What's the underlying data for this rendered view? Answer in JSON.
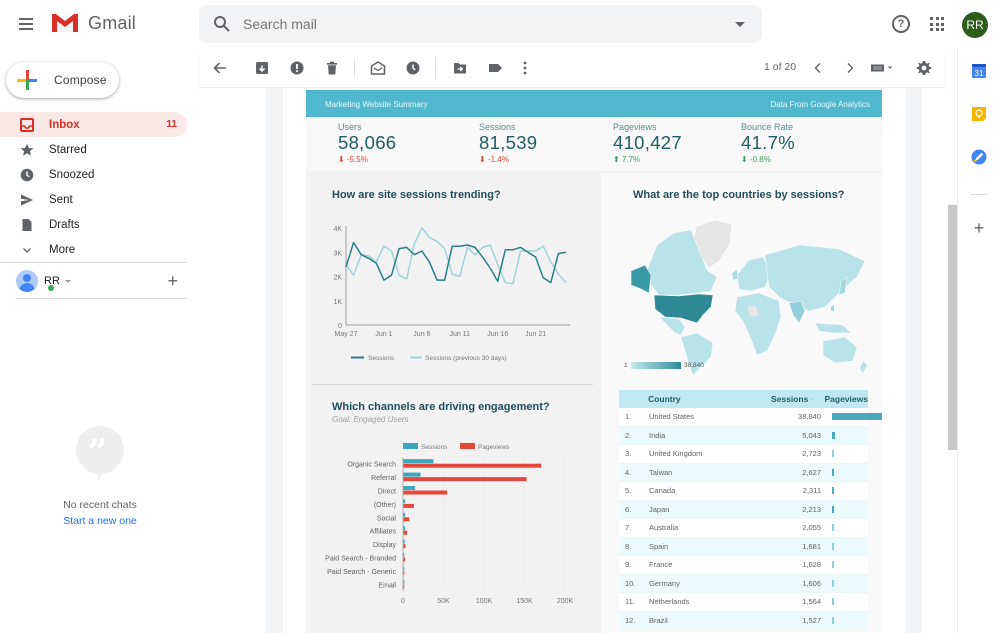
{
  "app": {
    "name": "Gmail",
    "search_placeholder": "Search mail",
    "avatar_initials": "RR"
  },
  "sidebar": {
    "compose_label": "Compose",
    "items": [
      {
        "label": "Inbox",
        "icon": "inbox-icon",
        "count": "11",
        "active": true
      },
      {
        "label": "Starred",
        "icon": "star-icon",
        "count": "",
        "active": false
      },
      {
        "label": "Snoozed",
        "icon": "clock-icon",
        "count": "",
        "active": false
      },
      {
        "label": "Sent",
        "icon": "send-icon",
        "count": "",
        "active": false
      },
      {
        "label": "Drafts",
        "icon": "draft-icon",
        "count": "",
        "active": false
      },
      {
        "label": "More",
        "icon": "chevron-down-icon",
        "count": "",
        "active": false
      }
    ],
    "user_name": "RR",
    "chat_empty_text": "No recent chats",
    "chat_start_link": "Start a new one"
  },
  "toolbar": {
    "pager": "1 of 20",
    "icons": [
      "back-arrow-icon",
      "archive-icon",
      "report-spam-icon",
      "delete-icon",
      "mark-unread-icon",
      "snooze-icon",
      "move-to-icon",
      "label-icon",
      "more-vert-icon"
    ]
  },
  "right_rail": {
    "icons": [
      "calendar-icon",
      "keep-icon",
      "tasks-icon",
      "add-addon-icon"
    ],
    "calendar_day": "31"
  },
  "report": {
    "header_left": "Marketing Website Summary",
    "header_right": "Data From Google Analytics",
    "colors": {
      "header": "#4fb8cf",
      "sessions": "#3aa6bd",
      "pageviews": "#e5483b",
      "dark_line": "#2a7f8a",
      "light_line": "#9fd3d9"
    },
    "kpis": [
      {
        "label": "Users",
        "value": "58,066",
        "delta": "-5.5%",
        "direction": "down",
        "tone": "negative"
      },
      {
        "label": "Sessions",
        "value": "81,539",
        "delta": "-1.4%",
        "direction": "down",
        "tone": "negative"
      },
      {
        "label": "Pageviews",
        "value": "410,427",
        "delta": "7.7%",
        "direction": "up",
        "tone": "positive"
      },
      {
        "label": "Bounce Rate",
        "value": "41.7%",
        "delta": "-0.8%",
        "direction": "down",
        "tone": "positive"
      }
    ],
    "map": {
      "title": "What are the top countries by sessions?",
      "legend_min": "1",
      "legend_max": "38,840"
    },
    "table": {
      "headers": {
        "country": "Country",
        "sessions": "Sessions",
        "pageviews": "Pageviews",
        "sort_indicator": "-"
      },
      "rows": [
        {
          "rank": "1.",
          "country": "United States",
          "sessions": "38,840",
          "pageviews_share": 1.0
        },
        {
          "rank": "2.",
          "country": "India",
          "sessions": "5,043",
          "pageviews_share": 0.05
        },
        {
          "rank": "3.",
          "country": "United Kingdom",
          "sessions": "2,723",
          "pageviews_share": 0.03
        },
        {
          "rank": "4.",
          "country": "Taiwan",
          "sessions": "2,627",
          "pageviews_share": 0.04
        },
        {
          "rank": "5.",
          "country": "Canada",
          "sessions": "2,311",
          "pageviews_share": 0.04
        },
        {
          "rank": "6.",
          "country": "Japan",
          "sessions": "2,213",
          "pageviews_share": 0.04
        },
        {
          "rank": "7.",
          "country": "Australia",
          "sessions": "2,055",
          "pageviews_share": 0.03
        },
        {
          "rank": "8.",
          "country": "Spain",
          "sessions": "1,681",
          "pageviews_share": 0.03
        },
        {
          "rank": "9.",
          "country": "France",
          "sessions": "1,628",
          "pageviews_share": 0.03
        },
        {
          "rank": "10.",
          "country": "Germany",
          "sessions": "1,606",
          "pageviews_share": 0.03
        },
        {
          "rank": "11.",
          "country": "Netherlands",
          "sessions": "1,564",
          "pageviews_share": 0.03
        },
        {
          "rank": "12.",
          "country": "Brazil",
          "sessions": "1,527",
          "pageviews_share": 0.03
        }
      ]
    }
  },
  "chart_data": [
    {
      "type": "line",
      "title": "How are site sessions trending?",
      "xlabel": "",
      "ylabel": "",
      "ylim": [
        0,
        4000
      ],
      "yticks": [
        "0",
        "1K",
        "2K",
        "3K",
        "4K"
      ],
      "xtick_labels": [
        "May 27",
        "Jun 1",
        "Jun 6",
        "Jun 11",
        "Jun 16",
        "Jun 21"
      ],
      "x": [
        "May 27",
        "May 28",
        "May 29",
        "May 30",
        "May 31",
        "Jun 1",
        "Jun 2",
        "Jun 3",
        "Jun 4",
        "Jun 5",
        "Jun 6",
        "Jun 7",
        "Jun 8",
        "Jun 9",
        "Jun 10",
        "Jun 11",
        "Jun 12",
        "Jun 13",
        "Jun 14",
        "Jun 15",
        "Jun 16",
        "Jun 17",
        "Jun 18",
        "Jun 19",
        "Jun 20",
        "Jun 21",
        "Jun 22",
        "Jun 23",
        "Jun 24",
        "Jun 25"
      ],
      "series": [
        {
          "name": "Sessions",
          "values": [
            2400,
            3400,
            2900,
            2750,
            2550,
            1850,
            2050,
            3150,
            3200,
            2900,
            3050,
            2600,
            1850,
            1850,
            3250,
            3250,
            3300,
            3200,
            2800,
            2350,
            1800,
            3100,
            3100,
            3200,
            3000,
            2800,
            1950,
            1750,
            2950,
            3000
          ]
        },
        {
          "name": "Sessions (previous 30 days)",
          "values": [
            2500,
            2050,
            2900,
            2850,
            2600,
            3250,
            3050,
            2050,
            1900,
            3350,
            4000,
            3600,
            3450,
            3150,
            2100,
            2000,
            3200,
            2900,
            3200,
            3300,
            2500,
            1750,
            1700,
            3050,
            3050,
            3050,
            3250,
            2600,
            2100,
            1750
          ]
        }
      ],
      "legend": "bottom"
    },
    {
      "type": "bar",
      "orientation": "horizontal",
      "title": "Which channels are driving engagement?",
      "subtitle": "Goal: Engaged Users",
      "categories": [
        "Organic Search",
        "Referral",
        "Direct",
        "(Other)",
        "Social",
        "Affiliates",
        "Display",
        "Paid Search - Branded",
        "Paid Search - Generic",
        "Email"
      ],
      "series": [
        {
          "name": "Sessions",
          "values": [
            37000,
            21000,
            14000,
            2000,
            2000,
            2000,
            1500,
            500,
            300,
            100
          ]
        },
        {
          "name": "Pageviews",
          "values": [
            170000,
            152000,
            54000,
            13000,
            7000,
            4500,
            2500,
            2000,
            1000,
            300
          ]
        }
      ],
      "xlim": [
        0,
        200000
      ],
      "xticks": [
        "0",
        "50K",
        "100K",
        "150K",
        "200K"
      ],
      "legend": "top"
    }
  ]
}
